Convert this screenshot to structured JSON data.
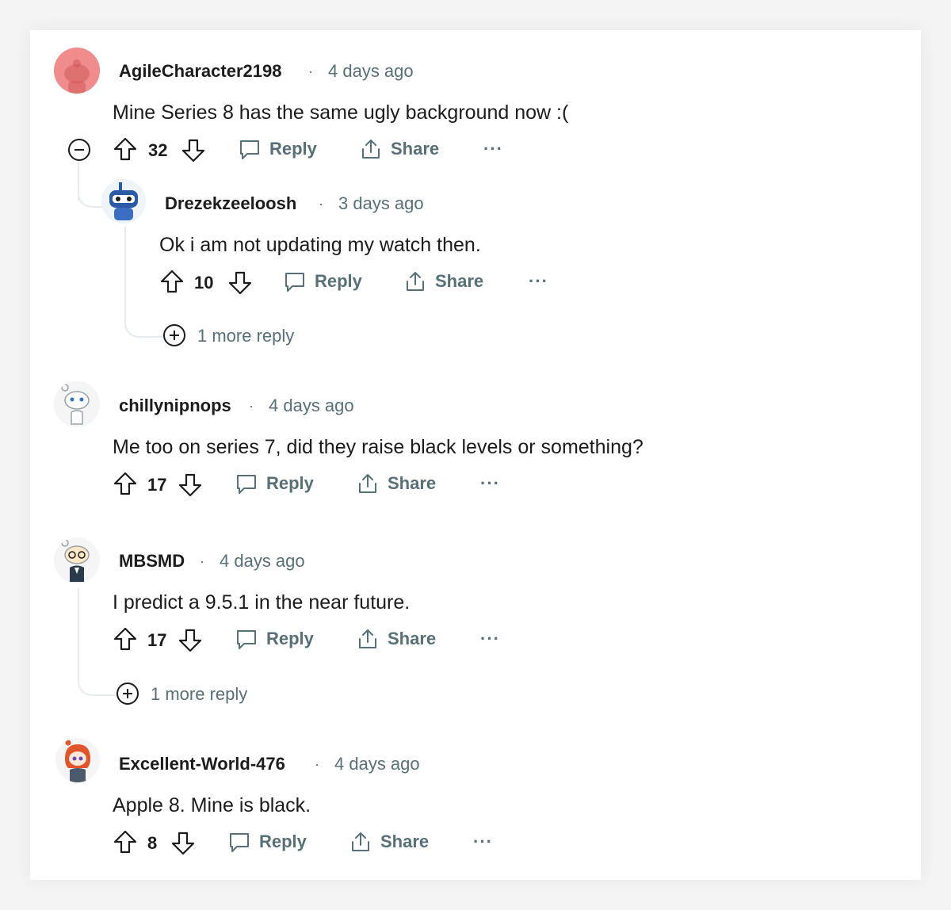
{
  "comments": [
    {
      "author": "AgileCharacter2198",
      "time": "4 days ago",
      "text": "Mine Series 8 has the same ugly background now :(",
      "score": "32",
      "avatar_color": "#f08c8c",
      "avatar_icon": "reddit-snoo-avatar-icon"
    },
    {
      "author": "Drezekzeeloosh",
      "time": "3 days ago",
      "text": "Ok i am not updating my watch then.",
      "score": "10",
      "more_replies": "1 more reply",
      "avatar_icon": "robot-snoo-avatar-icon"
    },
    {
      "author": "chillynipnops",
      "time": "4 days ago",
      "text": "Me too on series 7, did they raise black levels or something?",
      "score": "17",
      "avatar_icon": "snoo-avatar-icon"
    },
    {
      "author": "MBSMD",
      "time": "4 days ago",
      "text": "I predict a 9.5.1 in the near future.",
      "score": "17",
      "more_replies": "1 more reply",
      "avatar_icon": "glasses-snoo-avatar-icon"
    },
    {
      "author": "Excellent-World-476",
      "time": "4 days ago",
      "text": "Apple 8. Mine is black.",
      "score": "8",
      "avatar_icon": "redhair-snoo-avatar-icon"
    }
  ],
  "actions": {
    "separator": "·",
    "reply": "Reply",
    "share": "Share",
    "more": "···"
  },
  "colors": {
    "meta": "#576f76",
    "text": "#1c1c1c",
    "thread_line": "#e5ebee",
    "card": "#ffffff",
    "page": "#f4f4f4"
  }
}
